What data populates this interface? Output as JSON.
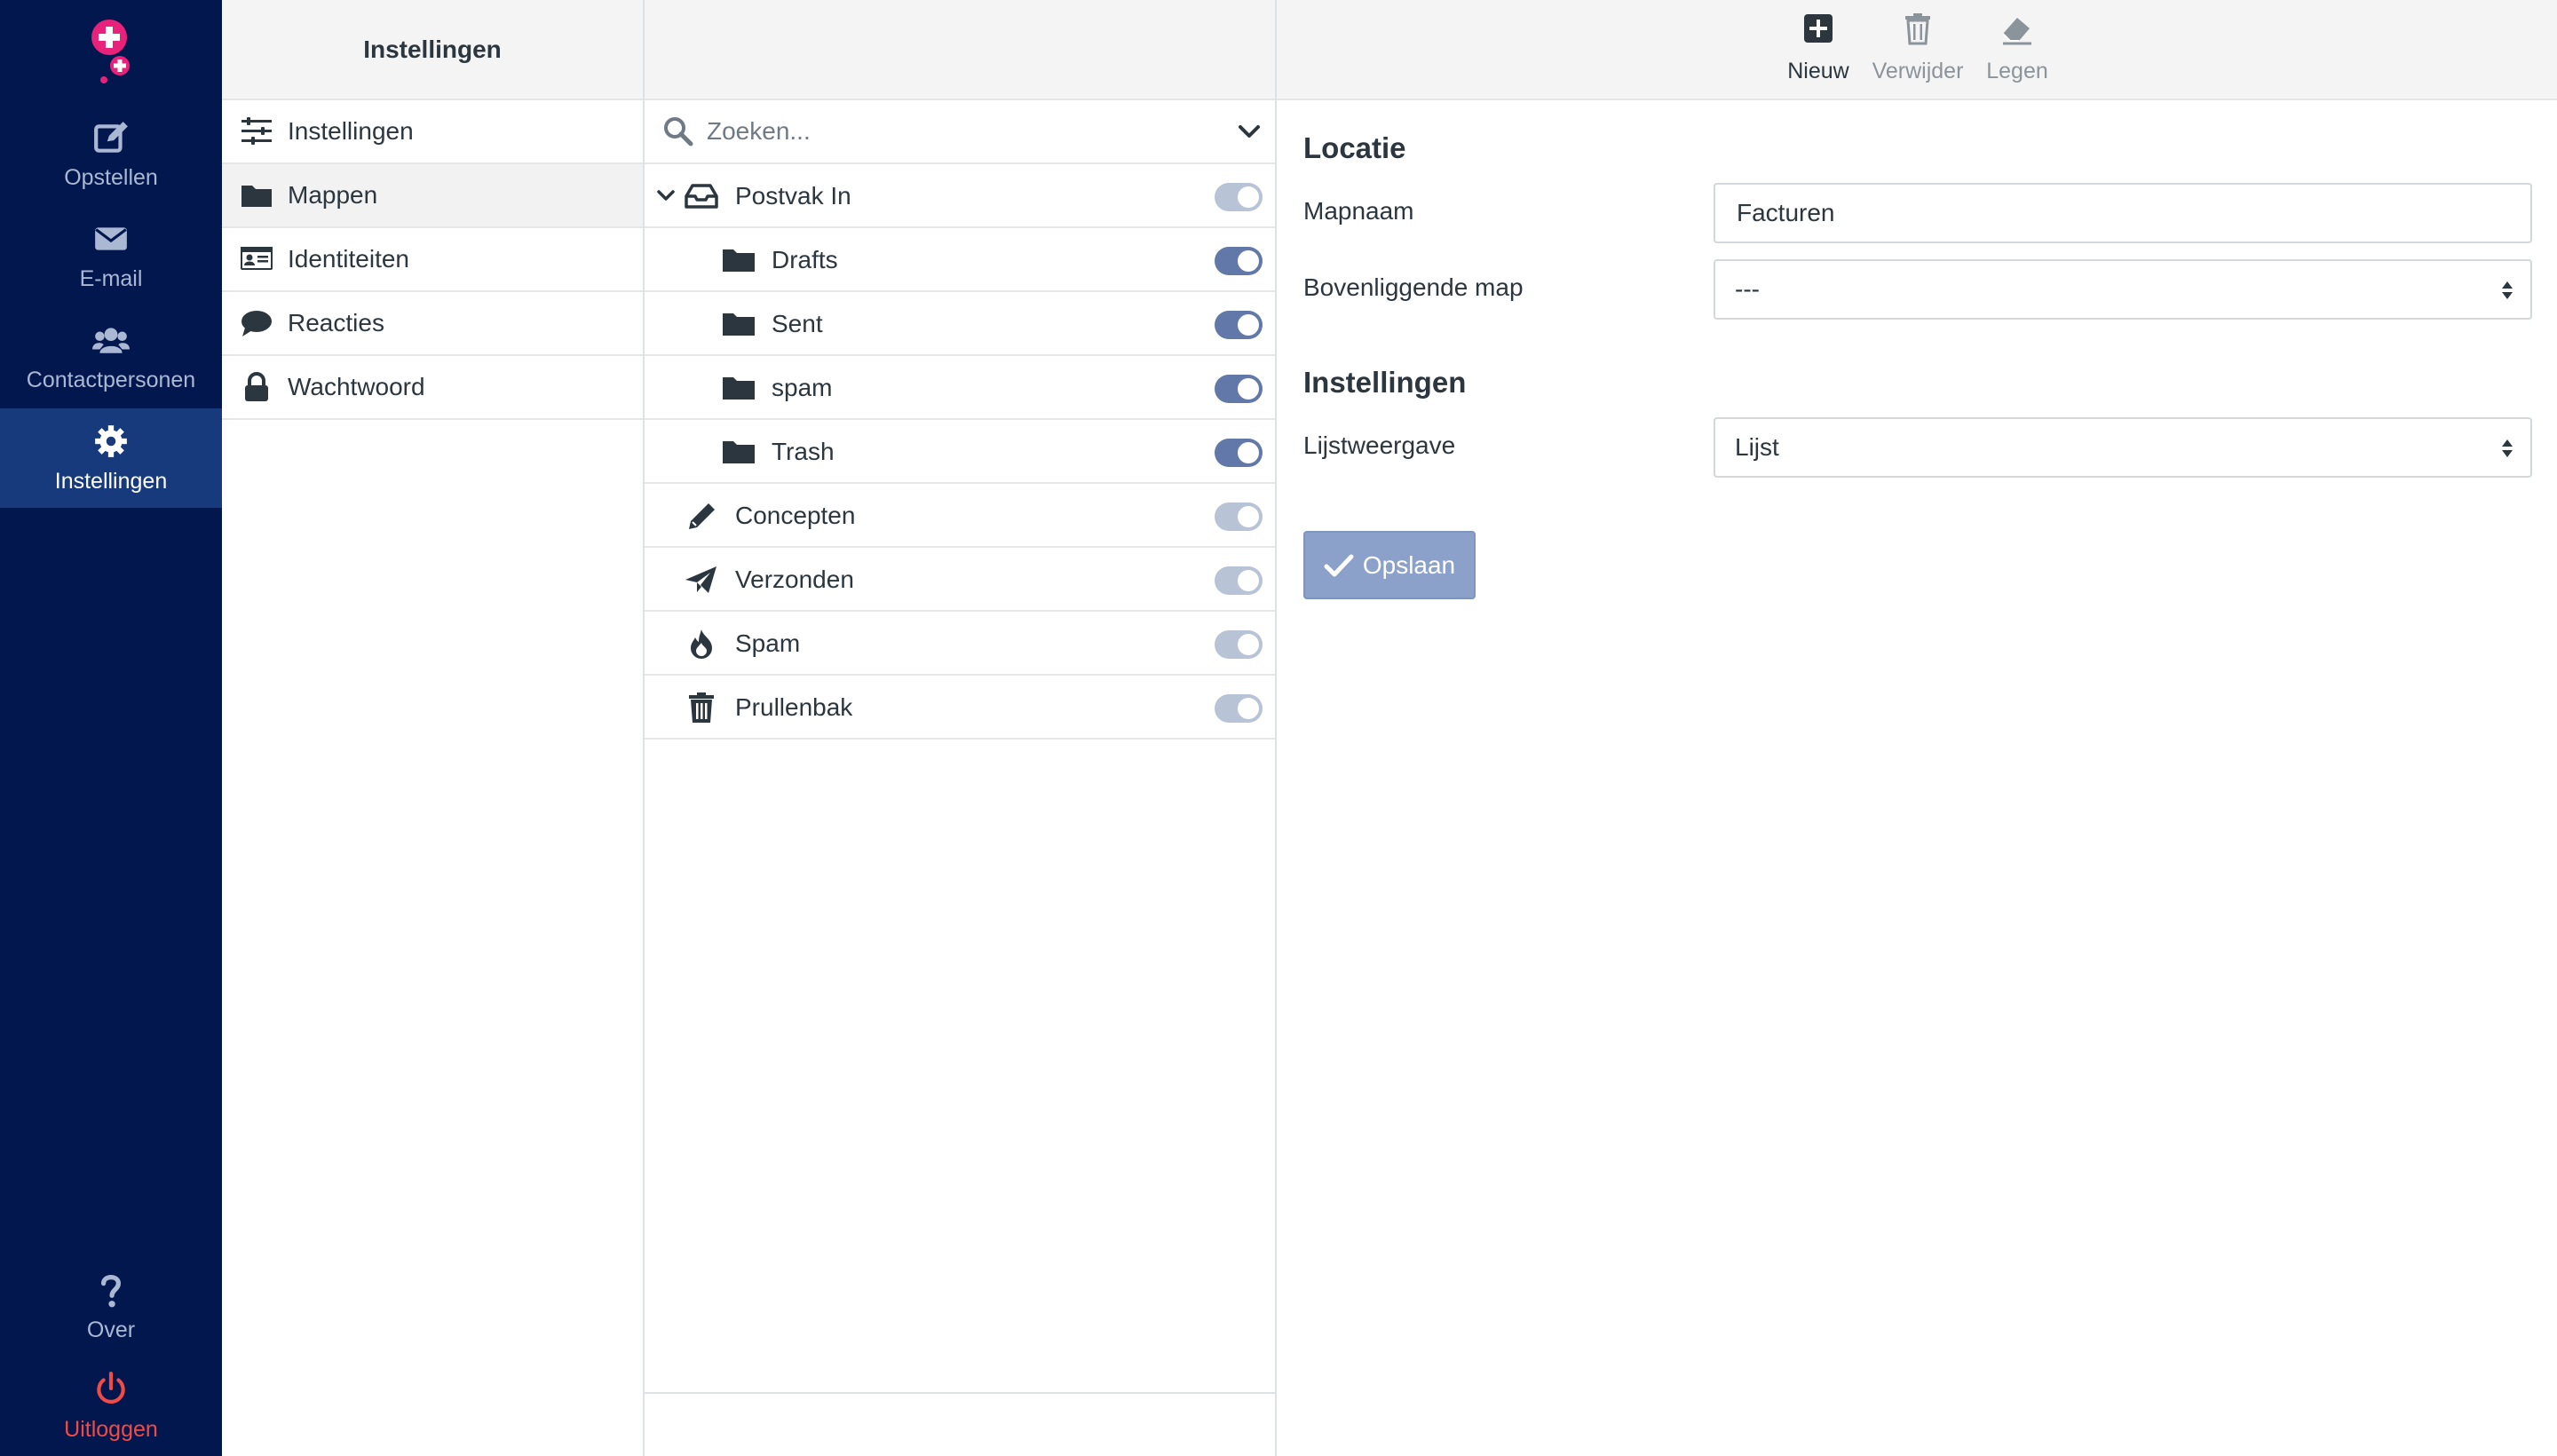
{
  "nav": {
    "items": [
      {
        "label": "Opstellen"
      },
      {
        "label": "E-mail"
      },
      {
        "label": "Contactpersonen"
      },
      {
        "label": "Instellingen"
      }
    ],
    "bottom": [
      {
        "label": "Over"
      },
      {
        "label": "Uitloggen"
      }
    ],
    "colors": {
      "background": "#03174f",
      "active": "#163a7c",
      "logout": "#f04b45",
      "logo": "#e8217a"
    }
  },
  "settings": {
    "header": "Instellingen",
    "items": [
      {
        "label": "Instellingen",
        "icon": "sliders-icon"
      },
      {
        "label": "Mappen",
        "icon": "folder-icon",
        "active": true
      },
      {
        "label": "Identiteiten",
        "icon": "id-card-icon"
      },
      {
        "label": "Reacties",
        "icon": "comment-icon"
      },
      {
        "label": "Wachtwoord",
        "icon": "lock-icon"
      }
    ]
  },
  "folders": {
    "search_placeholder": "Zoeken...",
    "items": [
      {
        "label": "Postvak In",
        "icon": "inbox-icon",
        "level": 0,
        "expanded": true,
        "subscribed": true,
        "toggle_dim": true
      },
      {
        "label": "Drafts",
        "icon": "folder-icon",
        "level": 1,
        "subscribed": true,
        "toggle_dim": false
      },
      {
        "label": "Sent",
        "icon": "folder-icon",
        "level": 1,
        "subscribed": true,
        "toggle_dim": false
      },
      {
        "label": "spam",
        "icon": "folder-icon",
        "level": 1,
        "subscribed": true,
        "toggle_dim": false
      },
      {
        "label": "Trash",
        "icon": "folder-icon",
        "level": 1,
        "subscribed": true,
        "toggle_dim": false
      },
      {
        "label": "Concepten",
        "icon": "pencil-icon",
        "level": 0,
        "subscribed": true,
        "toggle_dim": true
      },
      {
        "label": "Verzonden",
        "icon": "paper-plane-icon",
        "level": 0,
        "subscribed": true,
        "toggle_dim": true
      },
      {
        "label": "Spam",
        "icon": "fire-icon",
        "level": 0,
        "subscribed": true,
        "toggle_dim": true
      },
      {
        "label": "Prullenbak",
        "icon": "trash-icon",
        "level": 0,
        "subscribed": true,
        "toggle_dim": true
      }
    ]
  },
  "toolbar": {
    "new_label": "Nieuw",
    "delete_label": "Verwijder",
    "empty_label": "Legen"
  },
  "form": {
    "location_title": "Locatie",
    "name_label": "Mapnaam",
    "name_value": "Facturen",
    "parent_label": "Bovenliggende map",
    "parent_value": "---",
    "settings_title": "Instellingen",
    "listview_label": "Lijstweergave",
    "listview_value": "Lijst",
    "save_label": "Opslaan"
  }
}
